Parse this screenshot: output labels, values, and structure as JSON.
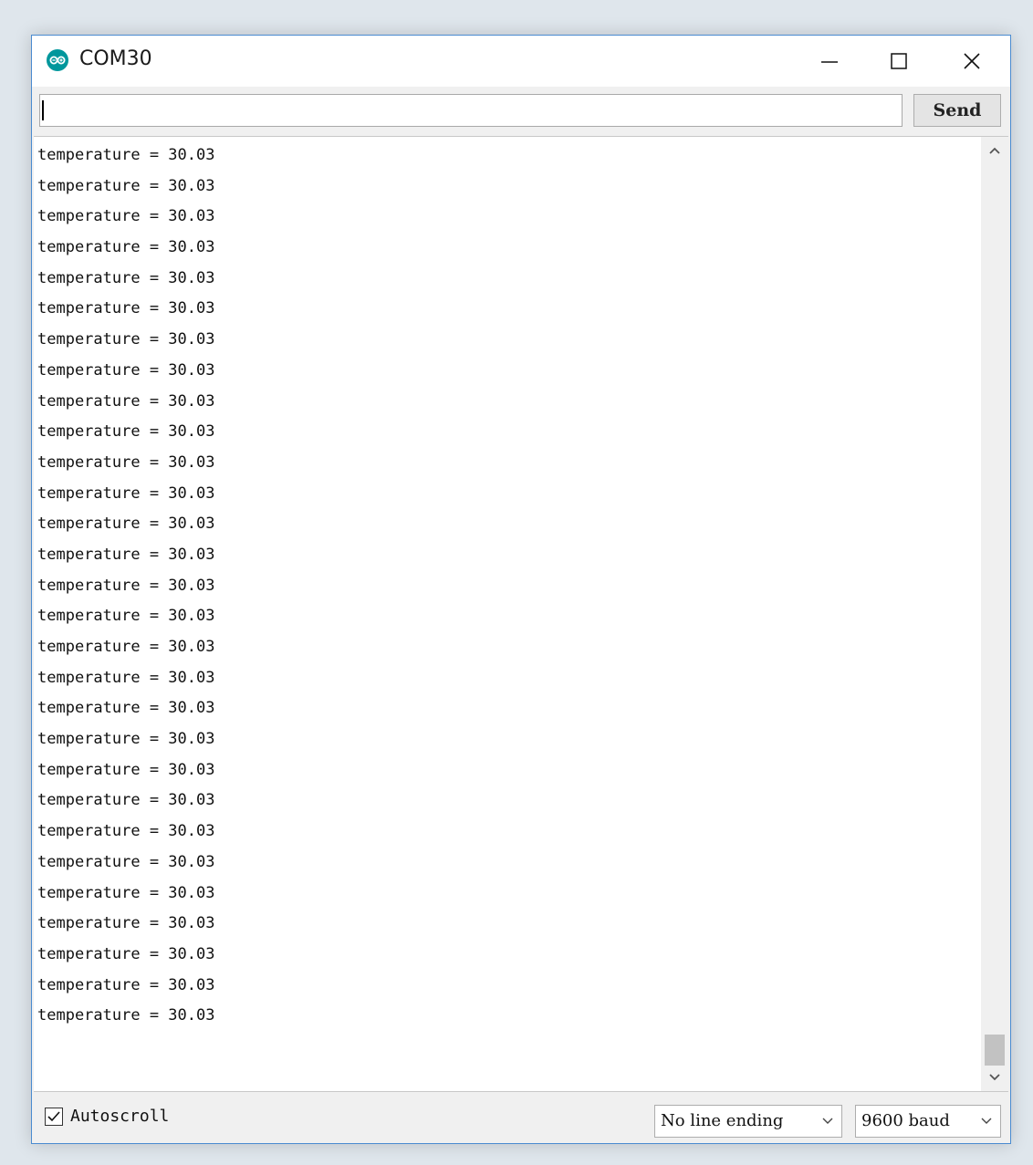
{
  "window": {
    "title": "COM30",
    "icon": "arduino-icon"
  },
  "send": {
    "input_value": "",
    "button_label": "Send"
  },
  "output": {
    "lines": [
      "temperature = 30.03",
      "temperature = 30.03",
      "temperature = 30.03",
      "temperature = 30.03",
      "temperature = 30.03",
      "temperature = 30.03",
      "temperature = 30.03",
      "temperature = 30.03",
      "temperature = 30.03",
      "temperature = 30.03",
      "temperature = 30.03",
      "temperature = 30.03",
      "temperature = 30.03",
      "temperature = 30.03",
      "temperature = 30.03",
      "temperature = 30.03",
      "temperature = 30.03",
      "temperature = 30.03",
      "temperature = 30.03",
      "temperature = 30.03",
      "temperature = 30.03",
      "temperature = 30.03",
      "temperature = 30.03",
      "temperature = 30.03",
      "temperature = 30.03",
      "temperature = 30.03",
      "temperature = 30.03",
      "temperature = 30.03",
      "temperature = 30.03"
    ],
    "scroll_position": "bottom"
  },
  "footer": {
    "autoscroll_label": "Autoscroll",
    "autoscroll_checked": true,
    "line_ending": "No line ending",
    "baud_rate": "9600 baud"
  },
  "colors": {
    "window_border": "#4a8bd0",
    "arduino_teal": "#00979c",
    "background": "#f0f0f0"
  }
}
